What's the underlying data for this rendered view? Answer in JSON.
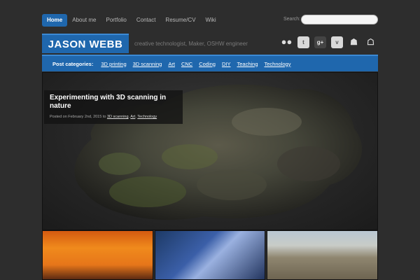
{
  "nav": {
    "items": [
      {
        "label": "Home",
        "active": true
      },
      {
        "label": "About me",
        "active": false
      },
      {
        "label": "Portfolio",
        "active": false
      },
      {
        "label": "Contact",
        "active": false
      },
      {
        "label": "Resume/CV",
        "active": false
      },
      {
        "label": "Wiki",
        "active": false
      }
    ],
    "search_label": "Search:",
    "search_value": ""
  },
  "header": {
    "brand": "JASON WEBB",
    "tagline": "creative technologist, Maker, OSHW engineer",
    "social": [
      {
        "icon": "flickr-icon",
        "glyph": "●●"
      },
      {
        "icon": "twitter-icon",
        "glyph": "t"
      },
      {
        "icon": "google-plus-icon",
        "glyph": "g+"
      },
      {
        "icon": "vimeo-icon",
        "glyph": "v"
      },
      {
        "icon": "github-icon",
        "glyph": "☗"
      },
      {
        "icon": "android-icon",
        "glyph": "☖"
      }
    ]
  },
  "categories": {
    "label": "Post categories:",
    "items": [
      "3D printing",
      "3D scanning",
      "Art",
      "CNC",
      "Coding",
      "DIY",
      "Teaching",
      "Technology"
    ]
  },
  "featured": {
    "title": "Experimenting with 3D scanning in nature",
    "meta_prefix": "Posted on February 2nd, 2015 to",
    "meta_cats": [
      "3D scanning",
      "Art",
      "Technology"
    ]
  },
  "colors": {
    "accent": "#1f67ad",
    "background": "#2d2d2d"
  }
}
